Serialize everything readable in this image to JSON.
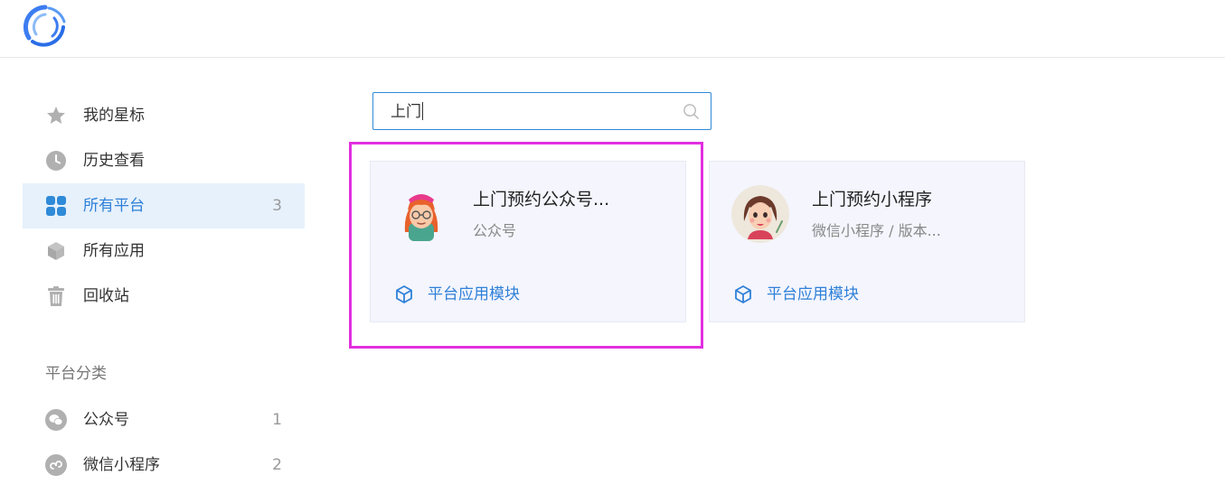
{
  "header": {
    "logo_icon": "app-logo-icon"
  },
  "sidebar": {
    "items": [
      {
        "icon": "star-icon",
        "label": "我的星标",
        "count": ""
      },
      {
        "icon": "clock-icon",
        "label": "历史查看",
        "count": ""
      },
      {
        "icon": "grid-icon",
        "label": "所有平台",
        "count": "3",
        "active": true
      },
      {
        "icon": "cube-icon",
        "label": "所有应用",
        "count": ""
      },
      {
        "icon": "trash-icon",
        "label": "回收站",
        "count": ""
      }
    ],
    "section_title": "平台分类",
    "categories": [
      {
        "icon": "wechat-icon",
        "label": "公众号",
        "count": "1"
      },
      {
        "icon": "mini-program-icon",
        "label": "微信小程序",
        "count": "2"
      }
    ]
  },
  "search": {
    "value": "上门",
    "icon": "search-icon"
  },
  "cards": [
    {
      "title": "上门预约公众号...",
      "subtitle": "公众号",
      "link_label": "平台应用模块",
      "selected": true
    },
    {
      "title": "上门预约小程序",
      "subtitle": "微信小程序 / 版本...",
      "link_label": "平台应用模块",
      "selected": false
    }
  ],
  "colors": {
    "accent": "#2f80d8",
    "active_bg": "#e6f1fc",
    "highlight": "#e22fe0",
    "card_bg": "#f4f5fd"
  }
}
